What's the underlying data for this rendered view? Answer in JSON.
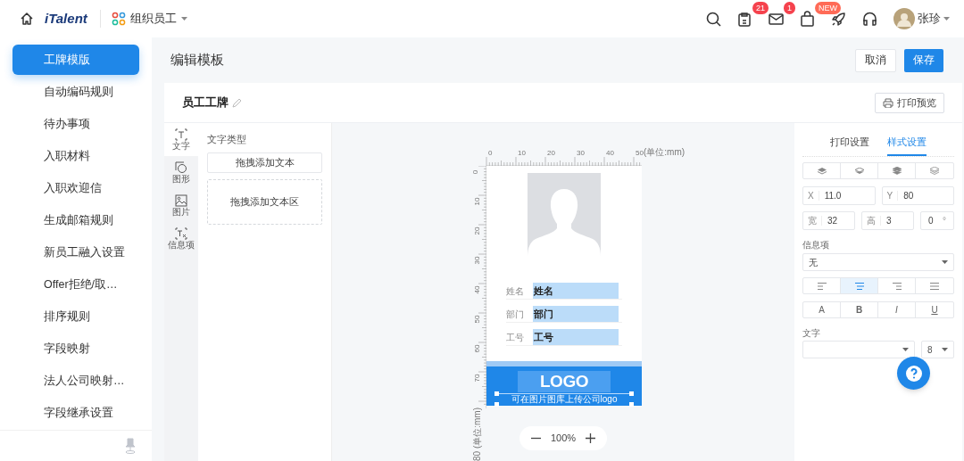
{
  "topbar": {
    "brand": "iTalent",
    "module": "组织员工",
    "icons": [
      {
        "kind": "search"
      },
      {
        "kind": "clipboard",
        "badge": "21"
      },
      {
        "kind": "mail",
        "badge": "1"
      },
      {
        "kind": "bag",
        "badge": "NEW"
      },
      {
        "kind": "rocket"
      },
      {
        "kind": "headset"
      }
    ],
    "user": "张珍"
  },
  "sidebar": {
    "items": [
      {
        "label": "工牌模版",
        "selected": true
      },
      {
        "label": "自动编码规则",
        "selected": false
      },
      {
        "label": "待办事项",
        "selected": false
      },
      {
        "label": "入职材料",
        "selected": false
      },
      {
        "label": "入职欢迎信",
        "selected": false
      },
      {
        "label": "生成邮箱规则",
        "selected": false
      },
      {
        "label": "新员工融入设置",
        "selected": false
      },
      {
        "label": "Offer拒绝/取…",
        "selected": false
      },
      {
        "label": "排序规则",
        "selected": false
      },
      {
        "label": "字段映射",
        "selected": false
      },
      {
        "label": "法人公司映射…",
        "selected": false
      },
      {
        "label": "字段继承设置",
        "selected": false
      }
    ]
  },
  "page_title": "编辑模板",
  "actions": [
    {
      "label": "取消",
      "primary": false
    },
    {
      "label": "保存",
      "primary": true
    }
  ],
  "card": {
    "title": "员工工牌",
    "print_preview": "打印预览"
  },
  "tool_tabs": [
    {
      "label": "文字",
      "kind": "text",
      "selected": true
    },
    {
      "label": "图形",
      "kind": "shape",
      "selected": false
    },
    {
      "label": "图片",
      "kind": "image",
      "selected": false
    },
    {
      "label": "信息项",
      "kind": "field",
      "selected": false
    }
  ],
  "text_panel": {
    "heading": "文字类型",
    "items": [
      {
        "label": "拖拽添加文本",
        "kind": "text"
      },
      {
        "label": "拖拽添加文本区",
        "kind": "area"
      }
    ]
  },
  "ruler": {
    "x_labels": [
      "0",
      "10",
      "20",
      "30",
      "40",
      "50"
    ],
    "x_unit": "(单位:mm)",
    "y_labels": [
      "0",
      "10",
      "20",
      "30",
      "40",
      "50",
      "60",
      "70"
    ],
    "y_unit": "80 (单位:mm)"
  },
  "badge": {
    "fields": [
      {
        "label": "姓名",
        "value": "姓名"
      },
      {
        "label": "部门",
        "value": "部门"
      },
      {
        "label": "工号",
        "value": "工号"
      }
    ],
    "logo": "LOGO",
    "logo_caption": "可在图片图库上传公司logo"
  },
  "zoom": {
    "value": "100%"
  },
  "settings": {
    "tabs": [
      {
        "label": "打印设置",
        "selected": false
      },
      {
        "label": "样式设置",
        "selected": true
      }
    ],
    "position": [
      {
        "label": "X",
        "value": "11.0"
      },
      {
        "label": "Y",
        "value": "80"
      }
    ],
    "size": [
      {
        "label": "宽",
        "value": "32"
      },
      {
        "label": "高",
        "value": "3"
      }
    ],
    "rotation": {
      "value": "0",
      "unit": "°"
    },
    "info_label": "信息项",
    "info_value": "无",
    "align": [
      {
        "kind": "left",
        "selected": false
      },
      {
        "kind": "center",
        "selected": true
      },
      {
        "kind": "right",
        "selected": false
      },
      {
        "kind": "justify",
        "selected": false
      }
    ],
    "font_styles": [
      {
        "label": "A",
        "kind": "normal"
      },
      {
        "label": "B",
        "kind": "bold"
      },
      {
        "label": "I",
        "kind": "italic"
      },
      {
        "label": "U",
        "kind": "underline"
      }
    ],
    "font_label": "文字",
    "font_size": "8"
  }
}
